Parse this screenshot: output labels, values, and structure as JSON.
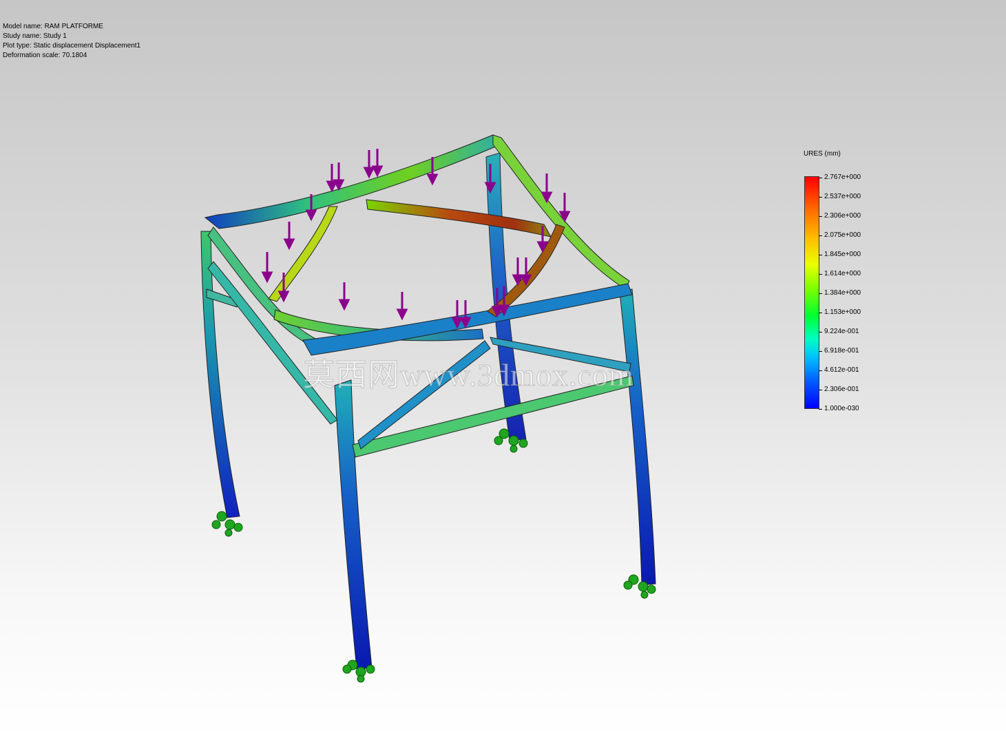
{
  "info": {
    "model_name": "Model name: RAM PLATFORME",
    "study_name": "Study name: Study 1",
    "plot_type": "Plot type: Static displacement Displacement1",
    "deformation_scale": "Deformation scale: 70.1804"
  },
  "legend": {
    "title": "URES (mm)",
    "ticks": [
      "2.767e+000",
      "2.537e+000",
      "2.306e+000",
      "2.075e+000",
      "1.845e+000",
      "1.614e+000",
      "1.384e+000",
      "1.153e+000",
      "9.224e-001",
      "6.918e-001",
      "4.612e-001",
      "2.306e-001",
      "1.000e-030"
    ],
    "max_color": "#ff0000",
    "min_color": "#0000ff"
  },
  "watermark": "莫西网www.3dmox.com",
  "colors": {
    "load_arrow": "#8b008b",
    "fixture": "#1fa51f"
  }
}
